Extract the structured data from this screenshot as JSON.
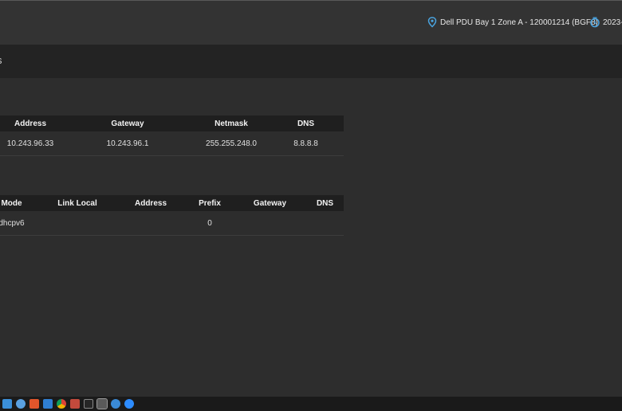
{
  "topbar": {
    "device_label": "Dell PDU Bay 1 Zone A - 120001214 (BGF8)",
    "time_label": "2023-"
  },
  "header": {
    "title_fragment": "s"
  },
  "ipv4_table": {
    "headers": [
      "Address",
      "Gateway",
      "Netmask",
      "DNS"
    ],
    "rows": [
      [
        "10.243.96.33",
        "10.243.96.1",
        "255.255.248.0",
        "8.8.8.8"
      ]
    ]
  },
  "ipv6_table": {
    "headers": [
      "Mode",
      "Link Local",
      "Address",
      "Prefix",
      "Gateway",
      "DNS"
    ],
    "rows": [
      [
        "dhcpv6",
        "",
        "",
        "0",
        "",
        ""
      ]
    ]
  },
  "taskbar": {
    "icons": [
      "windows-icon",
      "network-icon",
      "brave-icon",
      "edge-icon",
      "chrome-icon",
      "settings-icon",
      "terminal-icon",
      "app-icon",
      "remote-icon",
      "zoom-icon"
    ]
  },
  "colors": {
    "background": "#2d2d2d",
    "topbar": "#333333",
    "header_band": "#232323",
    "table_header": "#1f1f1f",
    "accent_blue": "#4aa3df"
  }
}
